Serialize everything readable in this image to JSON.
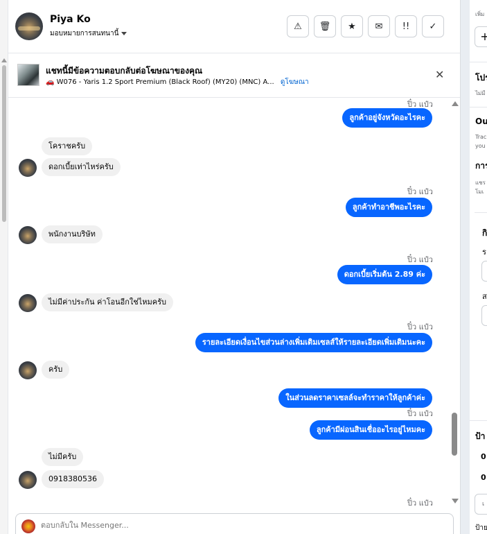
{
  "contact": {
    "name": "Piya Ko",
    "assign_label": "มอบหมายการสนทนานี้"
  },
  "toolbar": {
    "icons": [
      "warning-icon",
      "trash-icon",
      "star-icon",
      "mark-unread-icon",
      "priority-icon",
      "check-icon"
    ],
    "warning": "⚠",
    "trash": "🗑",
    "star": "★",
    "unread": "✉",
    "priority": "!!",
    "done": "✓"
  },
  "ad_banner": {
    "title": "แชทนี้มีข้อความตอบกลับต่อโฆษณาของคุณ",
    "car_icon": "🚗",
    "ad_name": "W076 - Yaris 1.2 Sport Premium (Black Roof) (MY20) (MNC) A...",
    "view_ad_label": "ดูโฆษณา",
    "close": "✕"
  },
  "messages": [
    {
      "meta": "ปิ๋ว แป๋ว"
    },
    {
      "out": "ลูกค้าอยู่จังหวัดอะไรคะ"
    },
    {
      "in": "โคราชครับ"
    },
    {
      "in": "ดอกเบี้ยเท่าไหร่ครับ"
    },
    {
      "meta": "ปิ๋ว แป๋ว"
    },
    {
      "out": "ลูกค้าทำอาชีพอะไรคะ"
    },
    {
      "in": "พนักงานบริษัท"
    },
    {
      "meta": "ปิ๋ว แป๋ว"
    },
    {
      "out": "ดอกเบี้ยเริ่มต้น 2.89 ค่ะ"
    },
    {
      "in": "ไม่มีค่าประกัน ค่าโอนอีกใช่ไหมครับ"
    },
    {
      "meta": "ปิ๋ว แป๋ว"
    },
    {
      "out": "รายละเอียดเงื่อนไขส่วนล่างเพิ่มเติมเซลส์ให้รายละเอียดเพิ่มเติมนะคะ"
    },
    {
      "in": "ครับ"
    },
    {
      "out": "ในส่วนลดราคาเซลล์จะทำราคาให้ลูกค้าค่ะ"
    },
    {
      "meta": "ปิ๋ว แป๋ว"
    },
    {
      "out": "ลูกค้ามีผ่อนสินเชื่ออะไรอยู่ไหมคะ"
    },
    {
      "in": "ไม่มีครับ"
    },
    {
      "in": "0918380536"
    },
    {
      "meta": "ปิ๋ว แป๋ว"
    }
  ],
  "composer": {
    "placeholder": "ตอบกลับใน Messenger..."
  },
  "right_panel": {
    "t1": "เพิ่ม",
    "plus": "+",
    "t2": "โปร",
    "t3": "ไม่มี",
    "t4": "Ou",
    "t5": "Trac",
    "t6": "you",
    "t7": "การ",
    "t8": "แชร",
    "t9": "โมเ",
    "t10": "กิ",
    "t11": "ร",
    "t12": "ส",
    "t13": "ป้า",
    "t14": "0",
    "t15": "0",
    "t16": "เ",
    "t17": "ป้าย"
  }
}
